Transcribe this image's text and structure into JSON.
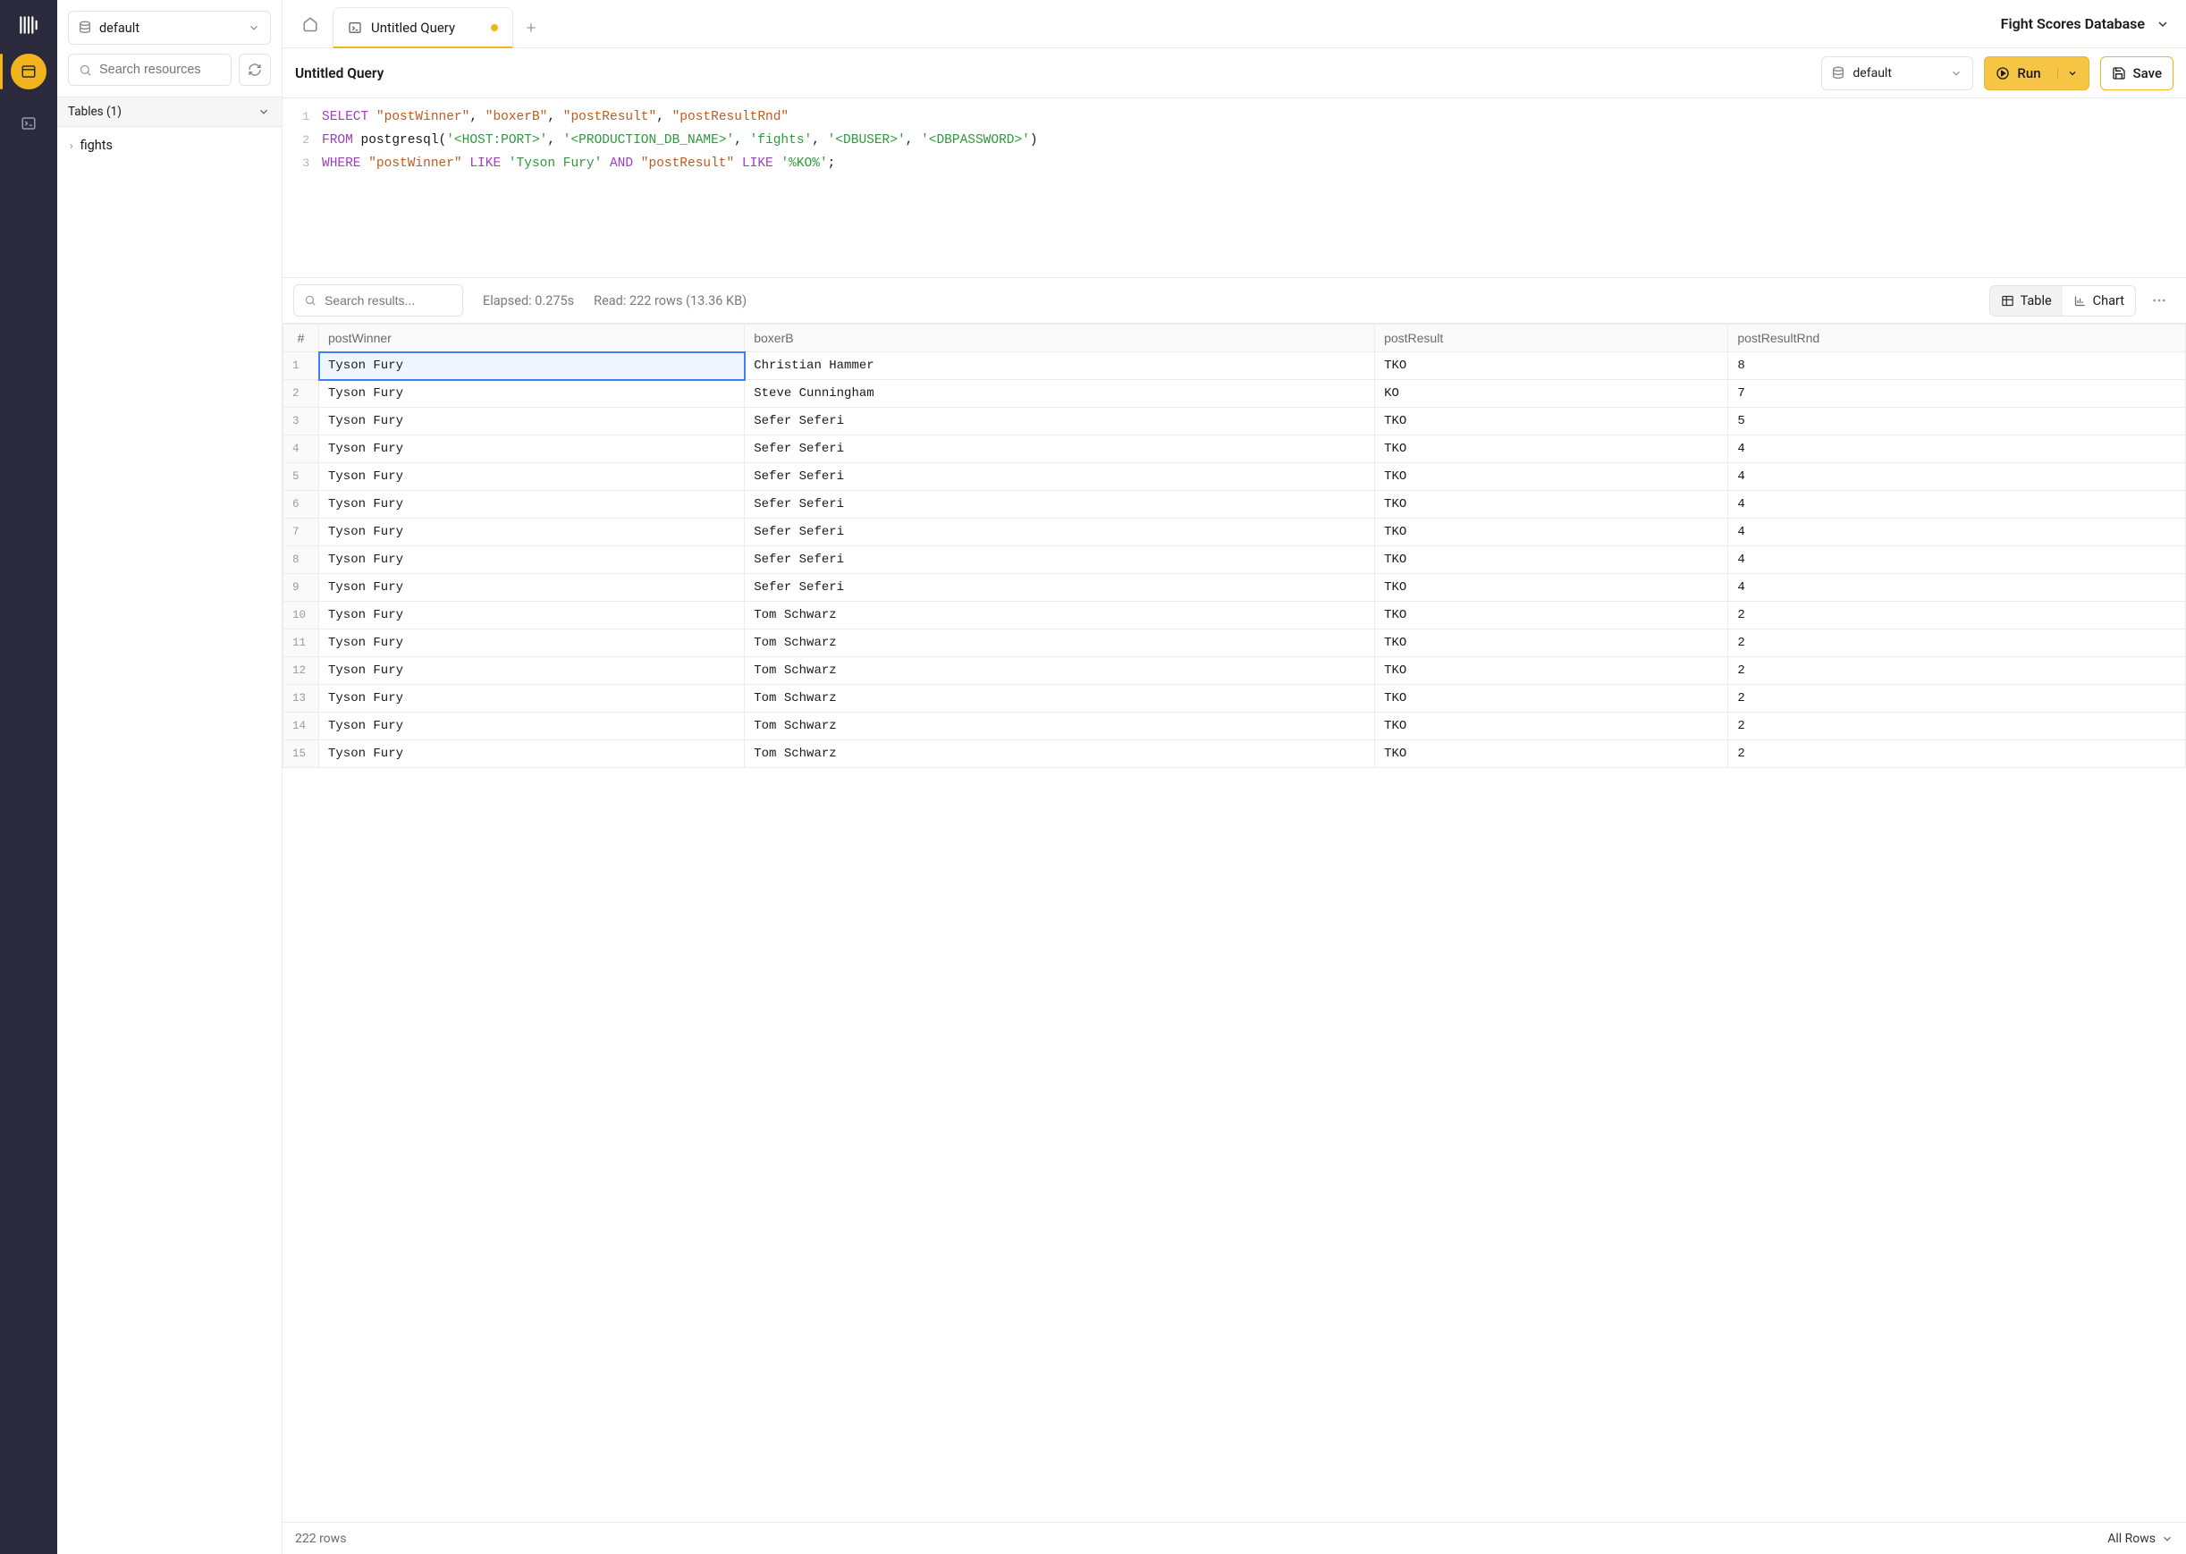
{
  "sidebar": {
    "database_selector": "default",
    "search_placeholder": "Search resources",
    "section_label": "Tables (1)",
    "items": [
      {
        "name": "fights"
      }
    ]
  },
  "tabs": {
    "active": {
      "title": "Untitled Query",
      "dirty": true
    }
  },
  "header": {
    "workspace": "Fight Scores Database"
  },
  "toolbar": {
    "title": "Untitled Query",
    "db": "default",
    "run_label": "Run",
    "save_label": "Save"
  },
  "editor": {
    "lines": [
      {
        "n": 1,
        "tokens": [
          {
            "t": "SELECT",
            "c": "kw"
          },
          {
            "t": " "
          },
          {
            "t": "\"postWinner\"",
            "c": "col"
          },
          {
            "t": ", "
          },
          {
            "t": "\"boxerB\"",
            "c": "col"
          },
          {
            "t": ", "
          },
          {
            "t": "\"postResult\"",
            "c": "col"
          },
          {
            "t": ", "
          },
          {
            "t": "\"postResultRnd\"",
            "c": "col"
          }
        ]
      },
      {
        "n": 2,
        "tokens": [
          {
            "t": "FROM",
            "c": "kw"
          },
          {
            "t": " postgresql("
          },
          {
            "t": "'<HOST:PORT>'",
            "c": "str"
          },
          {
            "t": ", "
          },
          {
            "t": "'<PRODUCTION_DB_NAME>'",
            "c": "str"
          },
          {
            "t": ", "
          },
          {
            "t": "'fights'",
            "c": "str"
          },
          {
            "t": ", "
          },
          {
            "t": "'<DBUSER>'",
            "c": "str"
          },
          {
            "t": ", "
          },
          {
            "t": "'<DBPASSWORD>'",
            "c": "str"
          },
          {
            "t": ")"
          }
        ]
      },
      {
        "n": 3,
        "tokens": [
          {
            "t": "WHERE",
            "c": "kw"
          },
          {
            "t": " "
          },
          {
            "t": "\"postWinner\"",
            "c": "col"
          },
          {
            "t": " "
          },
          {
            "t": "LIKE",
            "c": "op"
          },
          {
            "t": " "
          },
          {
            "t": "'Tyson Fury'",
            "c": "str"
          },
          {
            "t": " "
          },
          {
            "t": "AND",
            "c": "op"
          },
          {
            "t": " "
          },
          {
            "t": "\"postResult\"",
            "c": "col"
          },
          {
            "t": " "
          },
          {
            "t": "LIKE",
            "c": "op"
          },
          {
            "t": " "
          },
          {
            "t": "'%KO%'",
            "c": "str"
          },
          {
            "t": ";"
          }
        ]
      }
    ]
  },
  "results": {
    "search_placeholder": "Search results...",
    "elapsed": "Elapsed: 0.275s",
    "read": "Read: 222 rows (13.36 KB)",
    "view_table": "Table",
    "view_chart": "Chart",
    "columns": [
      "postWinner",
      "boxerB",
      "postResult",
      "postResultRnd"
    ],
    "rownum_header": "#",
    "rows": [
      [
        "Tyson Fury",
        "Christian Hammer",
        "TKO",
        "8"
      ],
      [
        "Tyson Fury",
        "Steve Cunningham",
        "KO",
        "7"
      ],
      [
        "Tyson Fury",
        "Sefer Seferi",
        "TKO",
        "5"
      ],
      [
        "Tyson Fury",
        "Sefer Seferi",
        "TKO",
        "4"
      ],
      [
        "Tyson Fury",
        "Sefer Seferi",
        "TKO",
        "4"
      ],
      [
        "Tyson Fury",
        "Sefer Seferi",
        "TKO",
        "4"
      ],
      [
        "Tyson Fury",
        "Sefer Seferi",
        "TKO",
        "4"
      ],
      [
        "Tyson Fury",
        "Sefer Seferi",
        "TKO",
        "4"
      ],
      [
        "Tyson Fury",
        "Sefer Seferi",
        "TKO",
        "4"
      ],
      [
        "Tyson Fury",
        "Tom Schwarz",
        "TKO",
        "2"
      ],
      [
        "Tyson Fury",
        "Tom Schwarz",
        "TKO",
        "2"
      ],
      [
        "Tyson Fury",
        "Tom Schwarz",
        "TKO",
        "2"
      ],
      [
        "Tyson Fury",
        "Tom Schwarz",
        "TKO",
        "2"
      ],
      [
        "Tyson Fury",
        "Tom Schwarz",
        "TKO",
        "2"
      ],
      [
        "Tyson Fury",
        "Tom Schwarz",
        "TKO",
        "2"
      ]
    ],
    "total_label": "222 rows",
    "pager_label": "All Rows"
  }
}
